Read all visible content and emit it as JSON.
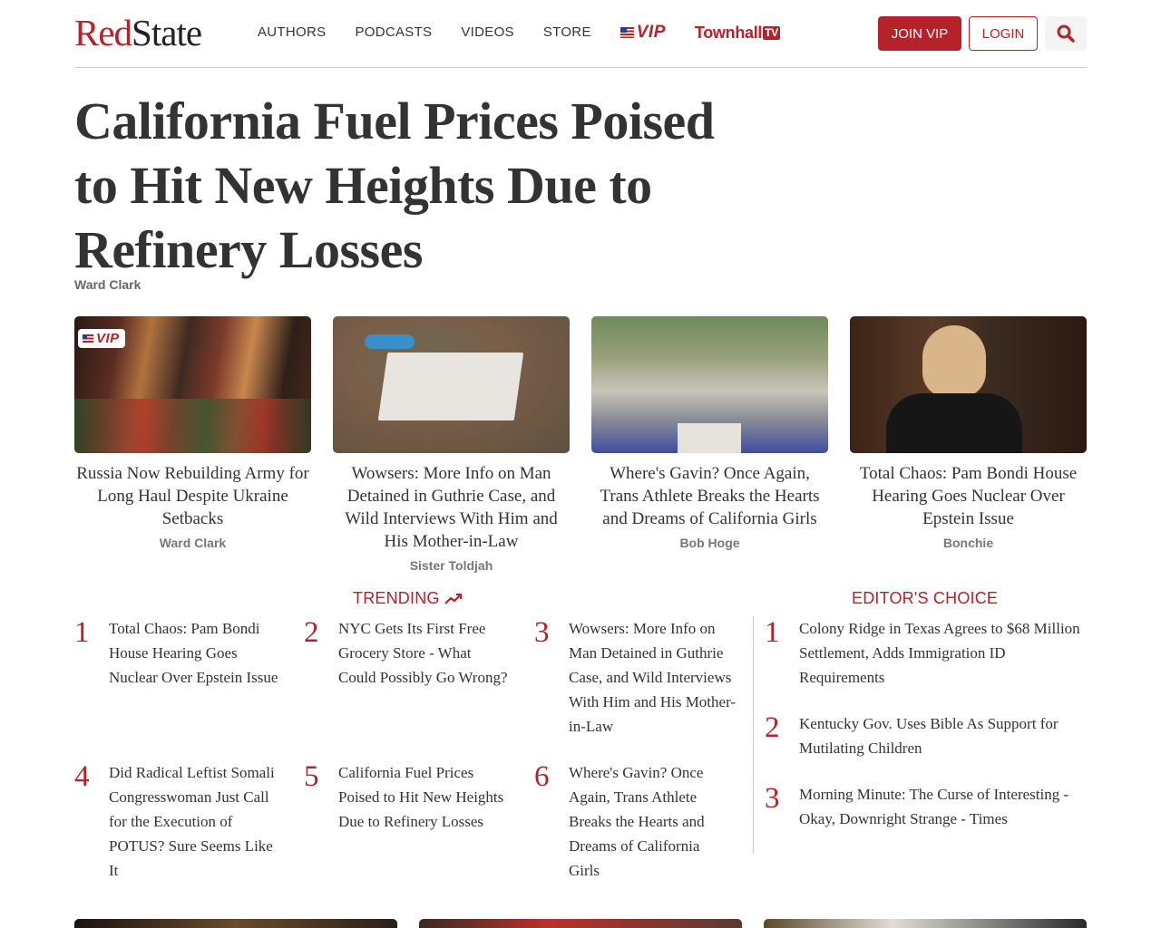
{
  "header": {
    "logo_red": "Red",
    "logo_dark": "State",
    "nav": [
      "AUTHORS",
      "PODCASTS",
      "VIDEOS",
      "STORE"
    ],
    "vip_label": "VIP",
    "townhall_label": "Townhall",
    "townhall_tv": "TV",
    "join_label": "JOIN VIP",
    "login_label": "LOGIN"
  },
  "headline": {
    "title": "California Fuel Prices Poised to Hit New Heights Due to Refinery Losses",
    "author": "Ward Clark"
  },
  "cards": [
    {
      "title": "Russia Now Rebuilding Army for Long Haul Despite Ukraine Setbacks",
      "author": "Ward Clark",
      "badge": "VIP"
    },
    {
      "title": "Wowsers: More Info on Man Detained in Guthrie Case, and Wild Interviews With Him and His Mother-in-Law",
      "author": "Sister Toldjah"
    },
    {
      "title": "Where's Gavin? Once Again, Trans Athlete Breaks the Hearts and Dreams of California Girls",
      "author": "Bob Hoge"
    },
    {
      "title": "Total Chaos: Pam Bondi House Hearing Goes Nuclear Over Epstein Issue",
      "author": "Bonchie"
    }
  ],
  "trending": {
    "label": "TRENDING",
    "items": [
      {
        "num": "1",
        "title": "Total Chaos: Pam Bondi House Hearing Goes Nuclear Over Epstein Issue"
      },
      {
        "num": "2",
        "title": "NYC Gets Its First Free Grocery Store - What Could Possibly Go Wrong?"
      },
      {
        "num": "3",
        "title": "Wowsers: More Info on Man Detained in Guthrie Case, and Wild Interviews With Him and His Mother-in-Law"
      },
      {
        "num": "4",
        "title": "Did Radical Leftist Somali Congresswoman Just Call for the Execution of POTUS? Sure Seems Like It"
      },
      {
        "num": "5",
        "title": "California Fuel Prices Poised to Hit New Heights Due to Refinery Losses"
      },
      {
        "num": "6",
        "title": "Where's Gavin? Once Again, Trans Athlete Breaks the Hearts and Dreams of California Girls"
      }
    ]
  },
  "editors_choice": {
    "label": "EDITOR'S CHOICE",
    "items": [
      {
        "num": "1",
        "title": "Colony Ridge in Texas Agrees to $68 Million Settlement, Adds Immigration ID Requirements"
      },
      {
        "num": "2",
        "title": "Kentucky Gov. Uses Bible As Support for Mutilating Children"
      },
      {
        "num": "3",
        "title": "Morning Minute: The Curse of Interesting - Okay, Downright Strange - Times"
      }
    ]
  },
  "colors": {
    "brand_red": "#b5222a",
    "text": "#333333",
    "muted": "#777777"
  }
}
